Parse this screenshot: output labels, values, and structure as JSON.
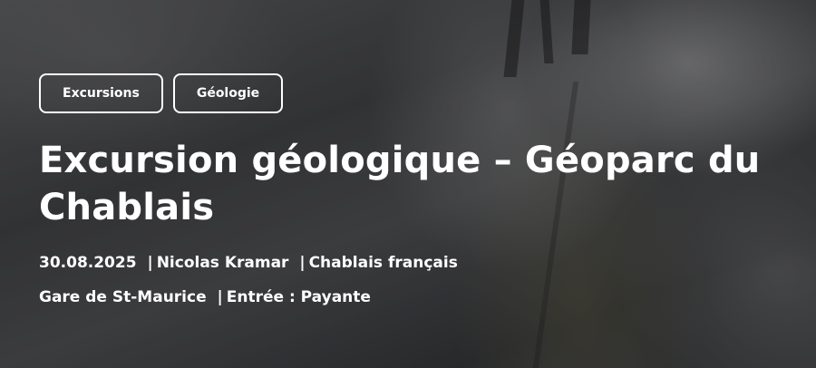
{
  "tags": [
    "Excursions",
    "Géologie"
  ],
  "title": "Excursion géologique – Géoparc du Chablais",
  "meta": {
    "date": "30.08.2025",
    "author": "Nicolas Kramar",
    "region": "Chablais français",
    "location": "Gare de St-Maurice",
    "entry": "Entrée : Payante",
    "separator": "|"
  },
  "background": {
    "image": "rock-gorge-photo",
    "text_color": "#ffffff"
  }
}
